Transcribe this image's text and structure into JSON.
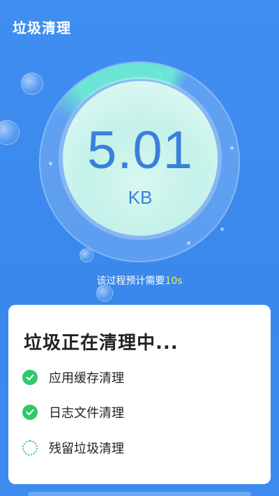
{
  "header": {
    "title": "垃圾清理"
  },
  "meter": {
    "value": "5.01",
    "unit": "KB"
  },
  "eta": {
    "prefix": "该过程预计需要",
    "time": "10s"
  },
  "card": {
    "title": "垃圾正在清理中...",
    "tasks": [
      {
        "label": "应用缓存清理",
        "status": "done"
      },
      {
        "label": "日志文件清理",
        "status": "done"
      },
      {
        "label": "残留垃圾清理",
        "status": "in-progress"
      }
    ]
  },
  "colors": {
    "accent": "#3f8ef0",
    "success": "#2fc96a",
    "highlight": "#f6e95a"
  }
}
